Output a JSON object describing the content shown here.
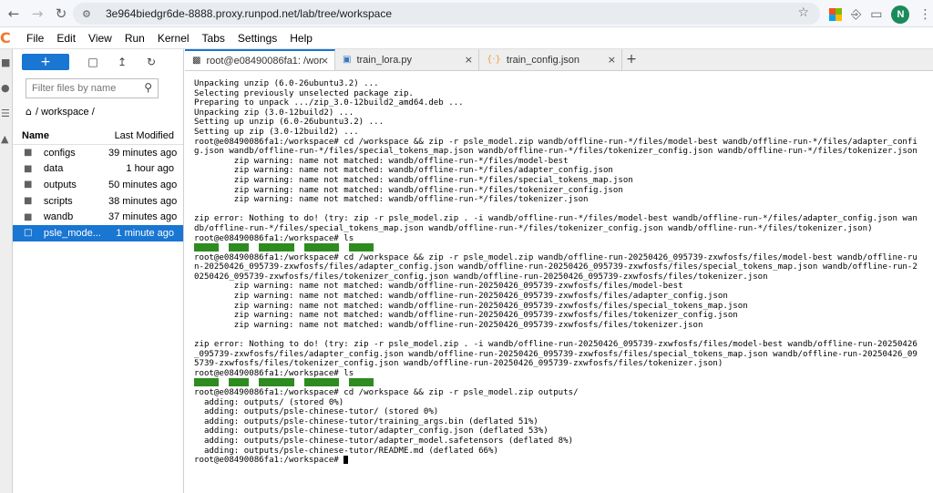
{
  "browser": {
    "url": "3e964biedgr6de-8888.proxy.runpod.net/lab/tree/workspace",
    "avatar_letter": "N"
  },
  "menu": [
    "File",
    "Edit",
    "View",
    "Run",
    "Kernel",
    "Tabs",
    "Settings",
    "Help"
  ],
  "filebrowser": {
    "new_label": "+",
    "filter_placeholder": "Filter files by name",
    "breadcrumb": "/ workspace /",
    "col_name": "Name",
    "col_modified": "Last Modified",
    "items": [
      {
        "name": "configs",
        "modified": "39 minutes ago",
        "type": "folder"
      },
      {
        "name": "data",
        "modified": "1 hour ago",
        "type": "folder"
      },
      {
        "name": "outputs",
        "modified": "50 minutes ago",
        "type": "folder"
      },
      {
        "name": "scripts",
        "modified": "38 minutes ago",
        "type": "folder"
      },
      {
        "name": "wandb",
        "modified": "37 minutes ago",
        "type": "folder"
      },
      {
        "name": "psle_mode...",
        "modified": "1 minute ago",
        "type": "file",
        "selected": true
      }
    ]
  },
  "tabs": [
    {
      "label": "root@e08490086fa1: /work",
      "icon": "terminal"
    },
    {
      "label": "train_lora.py",
      "icon": "python"
    },
    {
      "label": "train_config.json",
      "icon": "json"
    }
  ],
  "terminal": {
    "lines": [
      "Unpacking unzip (6.0-26ubuntu3.2) ...",
      "Selecting previously unselected package zip.",
      "Preparing to unpack .../zip_3.0-12build2_amd64.deb ...",
      "Unpacking zip (3.0-12build2) ...",
      "Setting up unzip (6.0-26ubuntu3.2) ...",
      "Setting up zip (3.0-12build2) ...",
      "root@e08490086fa1:/workspace# cd /workspace && zip -r psle_model.zip wandb/offline-run-*/files/model-best wandb/offline-run-*/files/adapter_confi",
      "g.json wandb/offline-run-*/files/special_tokens_map.json wandb/offline-run-*/files/tokenizer_config.json wandb/offline-run-*/files/tokenizer.json",
      "        zip warning: name not matched: wandb/offline-run-*/files/model-best",
      "        zip warning: name not matched: wandb/offline-run-*/files/adapter_config.json",
      "        zip warning: name not matched: wandb/offline-run-*/files/special_tokens_map.json",
      "        zip warning: name not matched: wandb/offline-run-*/files/tokenizer_config.json",
      "        zip warning: name not matched: wandb/offline-run-*/files/tokenizer.json",
      "",
      "zip error: Nothing to do! (try: zip -r psle_model.zip . -i wandb/offline-run-*/files/model-best wandb/offline-run-*/files/adapter_config.json wan",
      "db/offline-run-*/files/special_tokens_map.json wandb/offline-run-*/files/tokenizer_config.json wandb/offline-run-*/files/tokenizer.json)",
      "root@e08490086fa1:/workspace# ls",
      "@@LS@@",
      "root@e08490086fa1:/workspace# cd /workspace && zip -r psle_model.zip wandb/offline-run-20250426_095739-zxwfosfs/files/model-best wandb/offline-ru",
      "n-20250426_095739-zxwfosfs/files/adapter_config.json wandb/offline-run-20250426_095739-zxwfosfs/files/special_tokens_map.json wandb/offline-run-2",
      "0250426_095739-zxwfosfs/files/tokenizer_config.json wandb/offline-run-20250426_095739-zxwfosfs/files/tokenizer.json",
      "        zip warning: name not matched: wandb/offline-run-20250426_095739-zxwfosfs/files/model-best",
      "        zip warning: name not matched: wandb/offline-run-20250426_095739-zxwfosfs/files/adapter_config.json",
      "        zip warning: name not matched: wandb/offline-run-20250426_095739-zxwfosfs/files/special_tokens_map.json",
      "        zip warning: name not matched: wandb/offline-run-20250426_095739-zxwfosfs/files/tokenizer_config.json",
      "        zip warning: name not matched: wandb/offline-run-20250426_095739-zxwfosfs/files/tokenizer.json",
      "",
      "zip error: Nothing to do! (try: zip -r psle_model.zip . -i wandb/offline-run-20250426_095739-zxwfosfs/files/model-best wandb/offline-run-20250426",
      "_095739-zxwfosfs/files/adapter_config.json wandb/offline-run-20250426_095739-zxwfosfs/files/special_tokens_map.json wandb/offline-run-20250426_09",
      "5739-zxwfosfs/files/tokenizer_config.json wandb/offline-run-20250426_095739-zxwfosfs/files/tokenizer.json)",
      "root@e08490086fa1:/workspace# ls",
      "@@LS@@",
      "root@e08490086fa1:/workspace# cd /workspace && zip -r psle_model.zip outputs/",
      "  adding: outputs/ (stored 0%)",
      "  adding: outputs/psle-chinese-tutor/ (stored 0%)",
      "  adding: outputs/psle-chinese-tutor/training_args.bin (deflated 51%)",
      "  adding: outputs/psle-chinese-tutor/adapter_config.json (deflated 53%)",
      "  adding: outputs/psle-chinese-tutor/adapter_model.safetensors (deflated 8%)",
      "  adding: outputs/psle-chinese-tutor/README.md (deflated 66%)"
    ],
    "prompt": "root@e08490086fa1:/workspace# ",
    "ls_colors": {
      "dir_bg": "#2e8b20"
    }
  }
}
